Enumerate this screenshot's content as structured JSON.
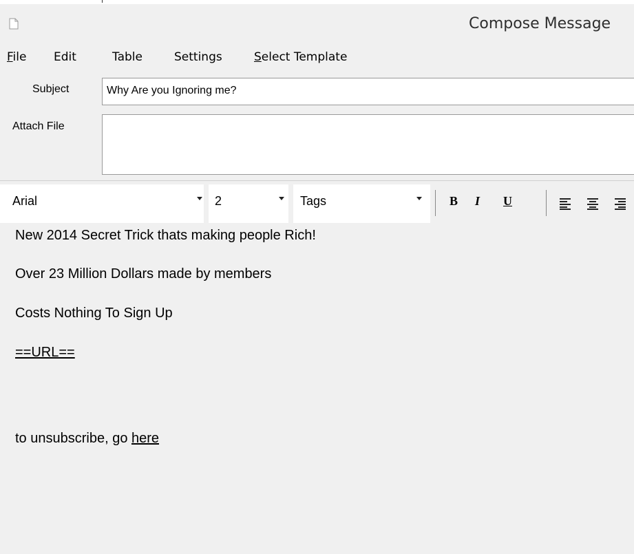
{
  "window": {
    "title": "Compose Message"
  },
  "menu": {
    "items": [
      {
        "label": "File",
        "mnemonic": "F",
        "rest": "ile"
      },
      {
        "label": "Edit",
        "mnemonic": "",
        "rest": "Edit"
      },
      {
        "label": "Table",
        "mnemonic": "",
        "rest": "Table"
      },
      {
        "label": "Settings",
        "mnemonic": "",
        "rest": "Settings"
      },
      {
        "label": "Select Template",
        "mnemonic": "S",
        "rest": "elect Template"
      }
    ]
  },
  "fields": {
    "subject_label": "Subject",
    "subject_value": "Why Are you Ignoring me?",
    "attach_label": "Attach File"
  },
  "toolbar": {
    "font": "Arial",
    "size": "2",
    "tags": "Tags",
    "bold": "B",
    "italic": "I",
    "underline": "U"
  },
  "body": {
    "lines": [
      "New 2014 Secret Trick thats making people Rich!",
      "Over 23 Million Dollars made by members",
      "Costs Nothing To Sign Up"
    ],
    "url_placeholder": "==URL==",
    "unsubscribe_prefix": "to unsubscribe, go ",
    "unsubscribe_link": "here"
  },
  "icons": {
    "app": "document-icon",
    "align_left": "align-left-icon",
    "align_center": "align-center-icon",
    "align_right": "align-right-icon"
  },
  "colors": {
    "window_bg": "#f0f0f0",
    "field_bg": "#ffffff",
    "border": "#999999"
  }
}
